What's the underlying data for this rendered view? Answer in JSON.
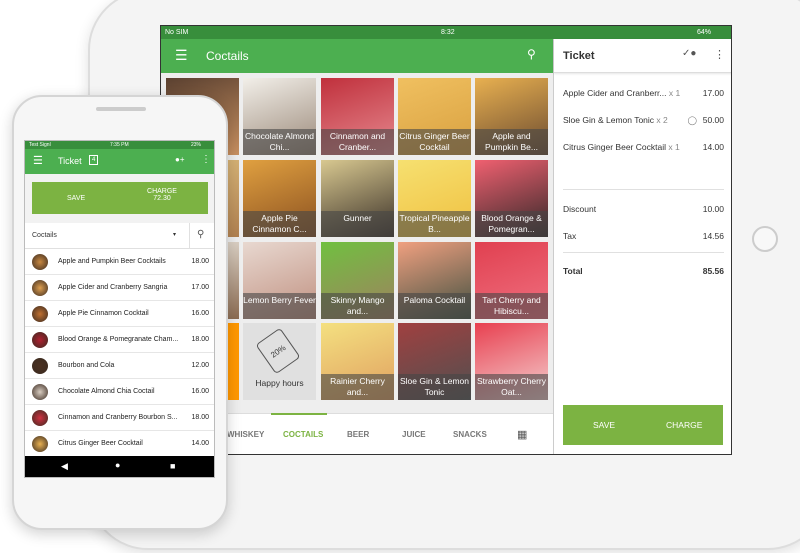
{
  "tablet": {
    "status": {
      "carrier": "No SIM",
      "time": "8:32",
      "battery": "64%"
    },
    "header": {
      "title": "Coctails",
      "menu_icon": "hamburger-icon",
      "search_icon": "search-icon"
    },
    "tiles": [
      {
        "label": "",
        "colors": [
          "#5a4030",
          "#c89060"
        ]
      },
      {
        "label": "Chocolate Almond Chi...",
        "colors": [
          "#f2efe9",
          "#9a8878"
        ]
      },
      {
        "label": "Cinnamon and Cranber...",
        "colors": [
          "#c0303c",
          "#e68a90"
        ]
      },
      {
        "label": "Citrus Ginger Beer Cocktail",
        "colors": [
          "#f0c060",
          "#d8a040"
        ]
      },
      {
        "label": "Apple and Pumpkin Be...",
        "colors": [
          "#e8b050",
          "#6a4a30"
        ]
      },
      {
        "label": "",
        "colors": [
          "#e0c080",
          "#b08050"
        ]
      },
      {
        "label": "Apple Pie Cinnamon C...",
        "colors": [
          "#e0a040",
          "#8a5020"
        ]
      },
      {
        "label": "Gunner",
        "colors": [
          "#d8c890",
          "#3a3028"
        ]
      },
      {
        "label": "Tropical Pineapple B...",
        "colors": [
          "#f6e070",
          "#f0c040"
        ]
      },
      {
        "label": "Blood Orange & Pomegran...",
        "colors": [
          "#f06070",
          "#302828"
        ]
      },
      {
        "label": "",
        "colors": [
          "#f4f0e8",
          "#8a6a50"
        ]
      },
      {
        "label": "Lemon Berry Fever",
        "colors": [
          "#e8d8d0",
          "#c09080"
        ]
      },
      {
        "label": "Skinny Mango and...",
        "colors": [
          "#70c040",
          "#a08060"
        ]
      },
      {
        "label": "Paloma Cocktail",
        "colors": [
          "#f0a080",
          "#405040"
        ]
      },
      {
        "label": "Tart Cherry and Hibiscu...",
        "colors": [
          "#e04050",
          "#f07080"
        ]
      },
      {
        "label": "",
        "colors": [
          "#ff9800",
          "#ff9800"
        ]
      },
      {
        "label": "Happy hours",
        "tag": "20%",
        "colors": [
          "#e0e0e0",
          "#e0e0e0"
        ]
      },
      {
        "label": "Rainier Cherry and...",
        "colors": [
          "#f4e080",
          "#e0a060"
        ]
      },
      {
        "label": "Sloe Gin & Lemon Tonic",
        "colors": [
          "#a04040",
          "#505050"
        ]
      },
      {
        "label": "Strawberry Cherry Oat...",
        "colors": [
          "#e84050",
          "#f4d0d0"
        ]
      }
    ],
    "tabs": [
      {
        "label": "WHISKEY",
        "active": false
      },
      {
        "label": "COCTAILS",
        "active": true
      },
      {
        "label": "BEER",
        "active": false
      },
      {
        "label": "JUICE",
        "active": false
      },
      {
        "label": "SNACKS",
        "active": false
      }
    ],
    "ticket": {
      "title": "Ticket",
      "items": [
        {
          "name": "Apple Cider and Cranberr...",
          "qty": "x 1",
          "price": "17.00",
          "discount": false
        },
        {
          "name": "Sloe Gin & Lemon Tonic",
          "qty": "x 2",
          "price": "50.00",
          "discount": true
        },
        {
          "name": "Citrus Ginger Beer Cocktail",
          "qty": "x 1",
          "price": "14.00",
          "discount": false
        }
      ],
      "discount_label": "Discount",
      "discount": "10.00",
      "tax_label": "Tax",
      "tax": "14.56",
      "total_label": "Total",
      "total": "85.56",
      "save": "SAVE",
      "charge": "CHARGE"
    }
  },
  "phone": {
    "status": {
      "carrier": "Test Signl",
      "time": "7:35 PM",
      "battery": "23%"
    },
    "header": {
      "title": "Ticket",
      "count": "4"
    },
    "save": "SAVE",
    "charge": "CHARGE",
    "charge_amount": "72.30",
    "category": "Coctails",
    "items": [
      {
        "name": "Apple and Pumpkin Beer Cocktails",
        "price": "18.00",
        "color": "#c88840"
      },
      {
        "name": "Apple Cider and Cranberry Sangria",
        "price": "17.00",
        "color": "#e0a050"
      },
      {
        "name": "Apple Pie Cinnamon Cocktail",
        "price": "16.00",
        "color": "#c07030"
      },
      {
        "name": "Blood Orange & Pomegranate Cham...",
        "price": "18.00",
        "color": "#b02030"
      },
      {
        "name": "Bourbon and Cola",
        "price": "12.00",
        "color": "#4a3020"
      },
      {
        "name": "Chocolate Almond Chia Coctail",
        "price": "16.00",
        "color": "#d8ccc0"
      },
      {
        "name": "Cinnamon and Cranberry Bourbon S...",
        "price": "18.00",
        "color": "#d03040"
      },
      {
        "name": "Citrus Ginger Beer Cocktail",
        "price": "14.00",
        "color": "#e8b050"
      }
    ]
  },
  "colors": {
    "green": "#4caf50",
    "dark_green": "#388e3c",
    "button_green": "#7cb342",
    "orange": "#ff9800"
  }
}
